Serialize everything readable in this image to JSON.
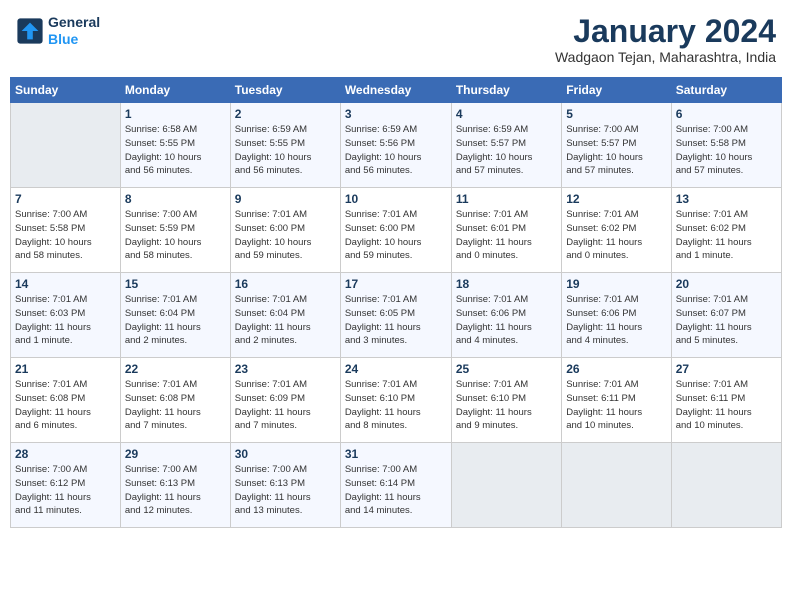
{
  "logo": {
    "line1": "General",
    "line2": "Blue"
  },
  "title": "January 2024",
  "subtitle": "Wadgaon Tejan, Maharashtra, India",
  "days_of_week": [
    "Sunday",
    "Monday",
    "Tuesday",
    "Wednesday",
    "Thursday",
    "Friday",
    "Saturday"
  ],
  "weeks": [
    [
      {
        "day": "",
        "info": ""
      },
      {
        "day": "1",
        "info": "Sunrise: 6:58 AM\nSunset: 5:55 PM\nDaylight: 10 hours\nand 56 minutes."
      },
      {
        "day": "2",
        "info": "Sunrise: 6:59 AM\nSunset: 5:55 PM\nDaylight: 10 hours\nand 56 minutes."
      },
      {
        "day": "3",
        "info": "Sunrise: 6:59 AM\nSunset: 5:56 PM\nDaylight: 10 hours\nand 56 minutes."
      },
      {
        "day": "4",
        "info": "Sunrise: 6:59 AM\nSunset: 5:57 PM\nDaylight: 10 hours\nand 57 minutes."
      },
      {
        "day": "5",
        "info": "Sunrise: 7:00 AM\nSunset: 5:57 PM\nDaylight: 10 hours\nand 57 minutes."
      },
      {
        "day": "6",
        "info": "Sunrise: 7:00 AM\nSunset: 5:58 PM\nDaylight: 10 hours\nand 57 minutes."
      }
    ],
    [
      {
        "day": "7",
        "info": "Sunrise: 7:00 AM\nSunset: 5:58 PM\nDaylight: 10 hours\nand 58 minutes."
      },
      {
        "day": "8",
        "info": "Sunrise: 7:00 AM\nSunset: 5:59 PM\nDaylight: 10 hours\nand 58 minutes."
      },
      {
        "day": "9",
        "info": "Sunrise: 7:01 AM\nSunset: 6:00 PM\nDaylight: 10 hours\nand 59 minutes."
      },
      {
        "day": "10",
        "info": "Sunrise: 7:01 AM\nSunset: 6:00 PM\nDaylight: 10 hours\nand 59 minutes."
      },
      {
        "day": "11",
        "info": "Sunrise: 7:01 AM\nSunset: 6:01 PM\nDaylight: 11 hours\nand 0 minutes."
      },
      {
        "day": "12",
        "info": "Sunrise: 7:01 AM\nSunset: 6:02 PM\nDaylight: 11 hours\nand 0 minutes."
      },
      {
        "day": "13",
        "info": "Sunrise: 7:01 AM\nSunset: 6:02 PM\nDaylight: 11 hours\nand 1 minute."
      }
    ],
    [
      {
        "day": "14",
        "info": "Sunrise: 7:01 AM\nSunset: 6:03 PM\nDaylight: 11 hours\nand 1 minute."
      },
      {
        "day": "15",
        "info": "Sunrise: 7:01 AM\nSunset: 6:04 PM\nDaylight: 11 hours\nand 2 minutes."
      },
      {
        "day": "16",
        "info": "Sunrise: 7:01 AM\nSunset: 6:04 PM\nDaylight: 11 hours\nand 2 minutes."
      },
      {
        "day": "17",
        "info": "Sunrise: 7:01 AM\nSunset: 6:05 PM\nDaylight: 11 hours\nand 3 minutes."
      },
      {
        "day": "18",
        "info": "Sunrise: 7:01 AM\nSunset: 6:06 PM\nDaylight: 11 hours\nand 4 minutes."
      },
      {
        "day": "19",
        "info": "Sunrise: 7:01 AM\nSunset: 6:06 PM\nDaylight: 11 hours\nand 4 minutes."
      },
      {
        "day": "20",
        "info": "Sunrise: 7:01 AM\nSunset: 6:07 PM\nDaylight: 11 hours\nand 5 minutes."
      }
    ],
    [
      {
        "day": "21",
        "info": "Sunrise: 7:01 AM\nSunset: 6:08 PM\nDaylight: 11 hours\nand 6 minutes."
      },
      {
        "day": "22",
        "info": "Sunrise: 7:01 AM\nSunset: 6:08 PM\nDaylight: 11 hours\nand 7 minutes."
      },
      {
        "day": "23",
        "info": "Sunrise: 7:01 AM\nSunset: 6:09 PM\nDaylight: 11 hours\nand 7 minutes."
      },
      {
        "day": "24",
        "info": "Sunrise: 7:01 AM\nSunset: 6:10 PM\nDaylight: 11 hours\nand 8 minutes."
      },
      {
        "day": "25",
        "info": "Sunrise: 7:01 AM\nSunset: 6:10 PM\nDaylight: 11 hours\nand 9 minutes."
      },
      {
        "day": "26",
        "info": "Sunrise: 7:01 AM\nSunset: 6:11 PM\nDaylight: 11 hours\nand 10 minutes."
      },
      {
        "day": "27",
        "info": "Sunrise: 7:01 AM\nSunset: 6:11 PM\nDaylight: 11 hours\nand 10 minutes."
      }
    ],
    [
      {
        "day": "28",
        "info": "Sunrise: 7:00 AM\nSunset: 6:12 PM\nDaylight: 11 hours\nand 11 minutes."
      },
      {
        "day": "29",
        "info": "Sunrise: 7:00 AM\nSunset: 6:13 PM\nDaylight: 11 hours\nand 12 minutes."
      },
      {
        "day": "30",
        "info": "Sunrise: 7:00 AM\nSunset: 6:13 PM\nDaylight: 11 hours\nand 13 minutes."
      },
      {
        "day": "31",
        "info": "Sunrise: 7:00 AM\nSunset: 6:14 PM\nDaylight: 11 hours\nand 14 minutes."
      },
      {
        "day": "",
        "info": ""
      },
      {
        "day": "",
        "info": ""
      },
      {
        "day": "",
        "info": ""
      }
    ]
  ]
}
